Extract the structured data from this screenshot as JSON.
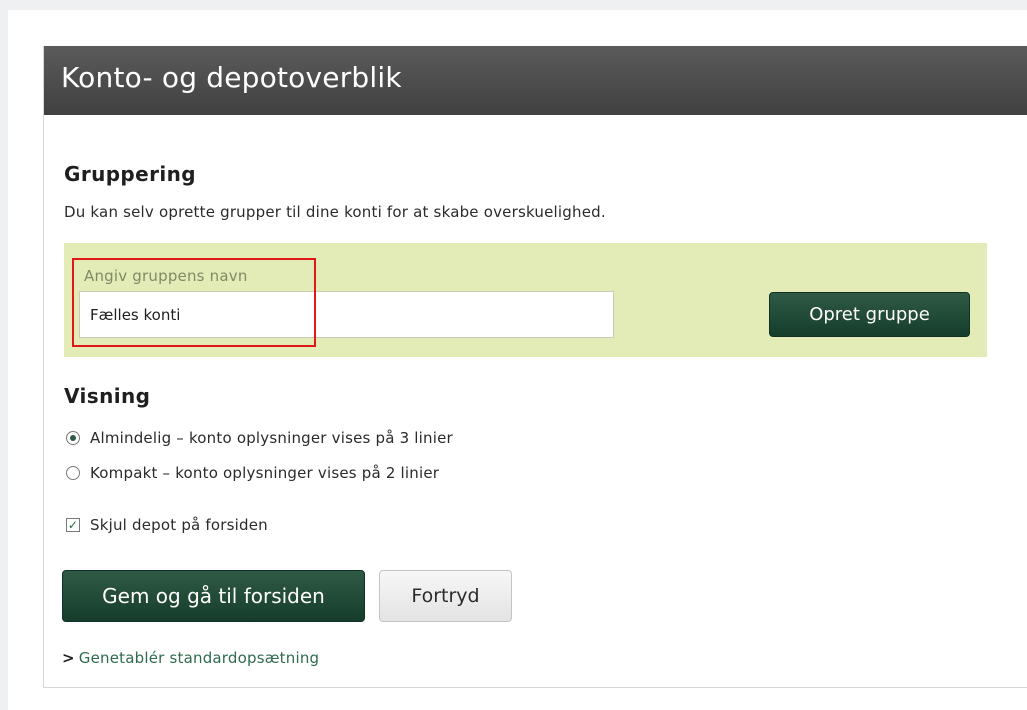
{
  "panel": {
    "title": "Konto- og depotoverblik"
  },
  "grouping": {
    "title": "Gruppering",
    "description": "Du kan selv oprette grupper til dine konti for at skabe overskuelighed.",
    "input_label": "Angiv gruppens navn",
    "input_value": "Fælles konti",
    "create_button": "Opret gruppe",
    "box_color": "#e3ecb6",
    "highlight_color": "#e01818"
  },
  "view": {
    "title": "Visning",
    "options": [
      {
        "label": "Almindelig – konto oplysninger vises på 3 linier",
        "selected": true
      },
      {
        "label": "Kompakt – konto oplysninger vises på 2 linier",
        "selected": false
      }
    ],
    "hide_depot_label": "Skjul depot på forsiden",
    "hide_depot_checked": true
  },
  "actions": {
    "save_button": "Gem og gå til forsiden",
    "cancel_button": "Fortryd",
    "reset_link": "Genetablér standardopsætning",
    "reset_link_icon": "chevron-right-icon"
  },
  "colors": {
    "header_bg": "#4a4a4a",
    "primary_button": "#1f4a36",
    "link": "#2e6b4f"
  }
}
